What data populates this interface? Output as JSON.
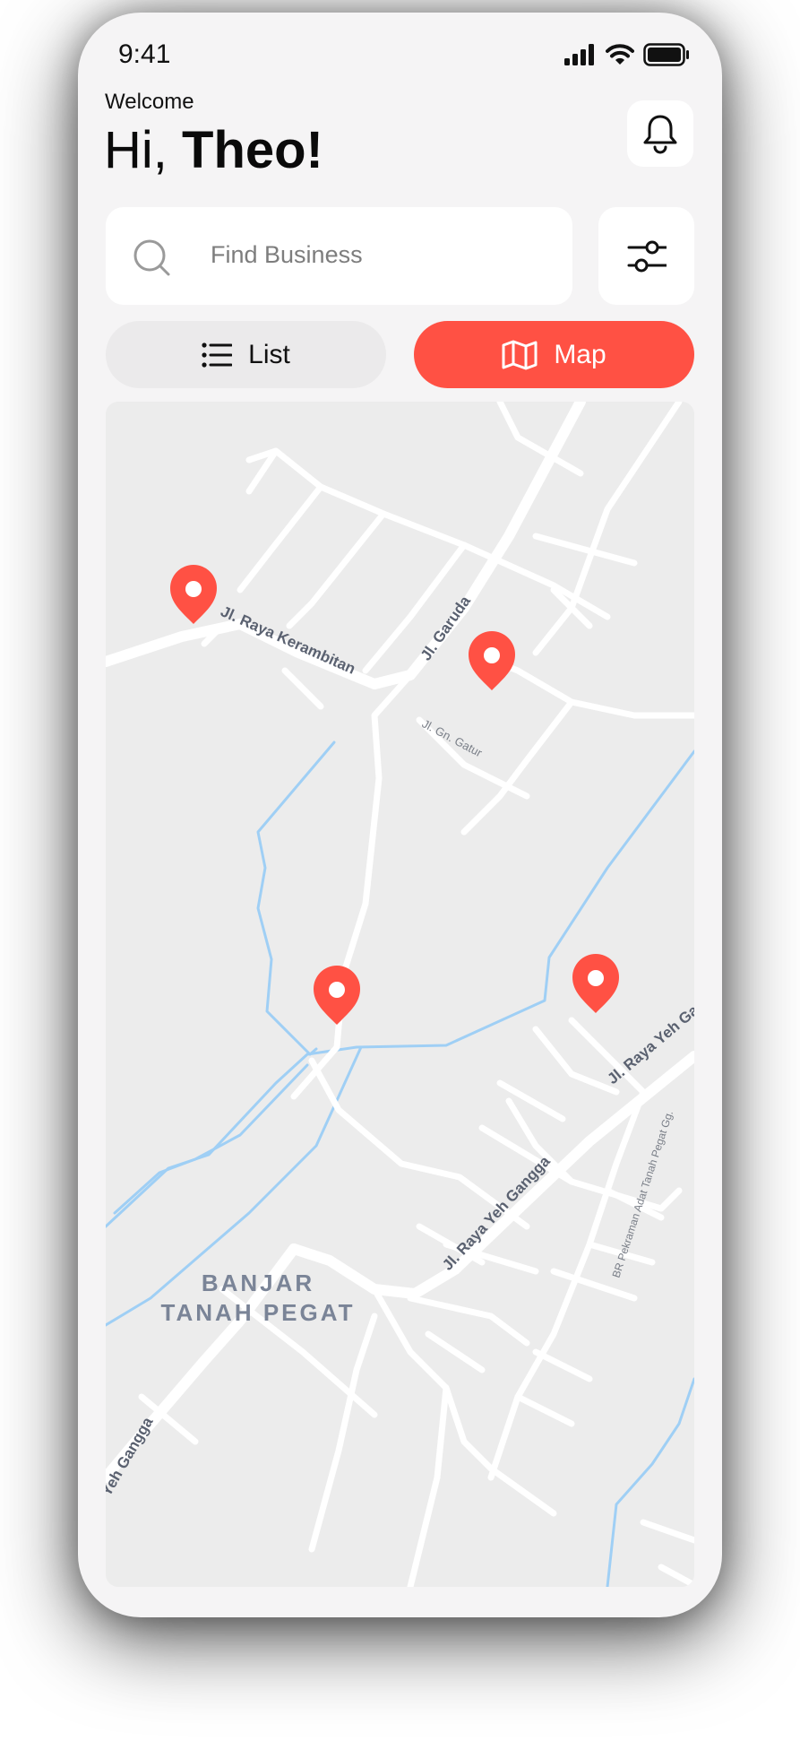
{
  "status_bar": {
    "time": "9:41"
  },
  "header": {
    "welcome": "Welcome",
    "greeting_prefix": "Hi,",
    "user_name": "Theo!"
  },
  "search": {
    "placeholder": "Find Business"
  },
  "view_toggle": {
    "list_label": "List",
    "map_label": "Map",
    "active": "map"
  },
  "map": {
    "streets": [
      "Jl. Raya Kerambitan",
      "Jl. Garuda",
      "Jl. Gn. Gatur",
      "Jl. Raya Yeh Gangga",
      "Jl. Raya Yeh Gangga",
      "BR Pekraman Adat Tanah Pegat Gg.",
      "Yeh Gangga"
    ],
    "area_name_line1": "BANJAR",
    "area_name_line2": "TANAH PEGAT",
    "pin_count": 4
  },
  "colors": {
    "accent": "#ff5144",
    "background": "#f5f4f5",
    "map_background": "#ececec",
    "road": "#ffffff",
    "water": "#9fcff5"
  }
}
